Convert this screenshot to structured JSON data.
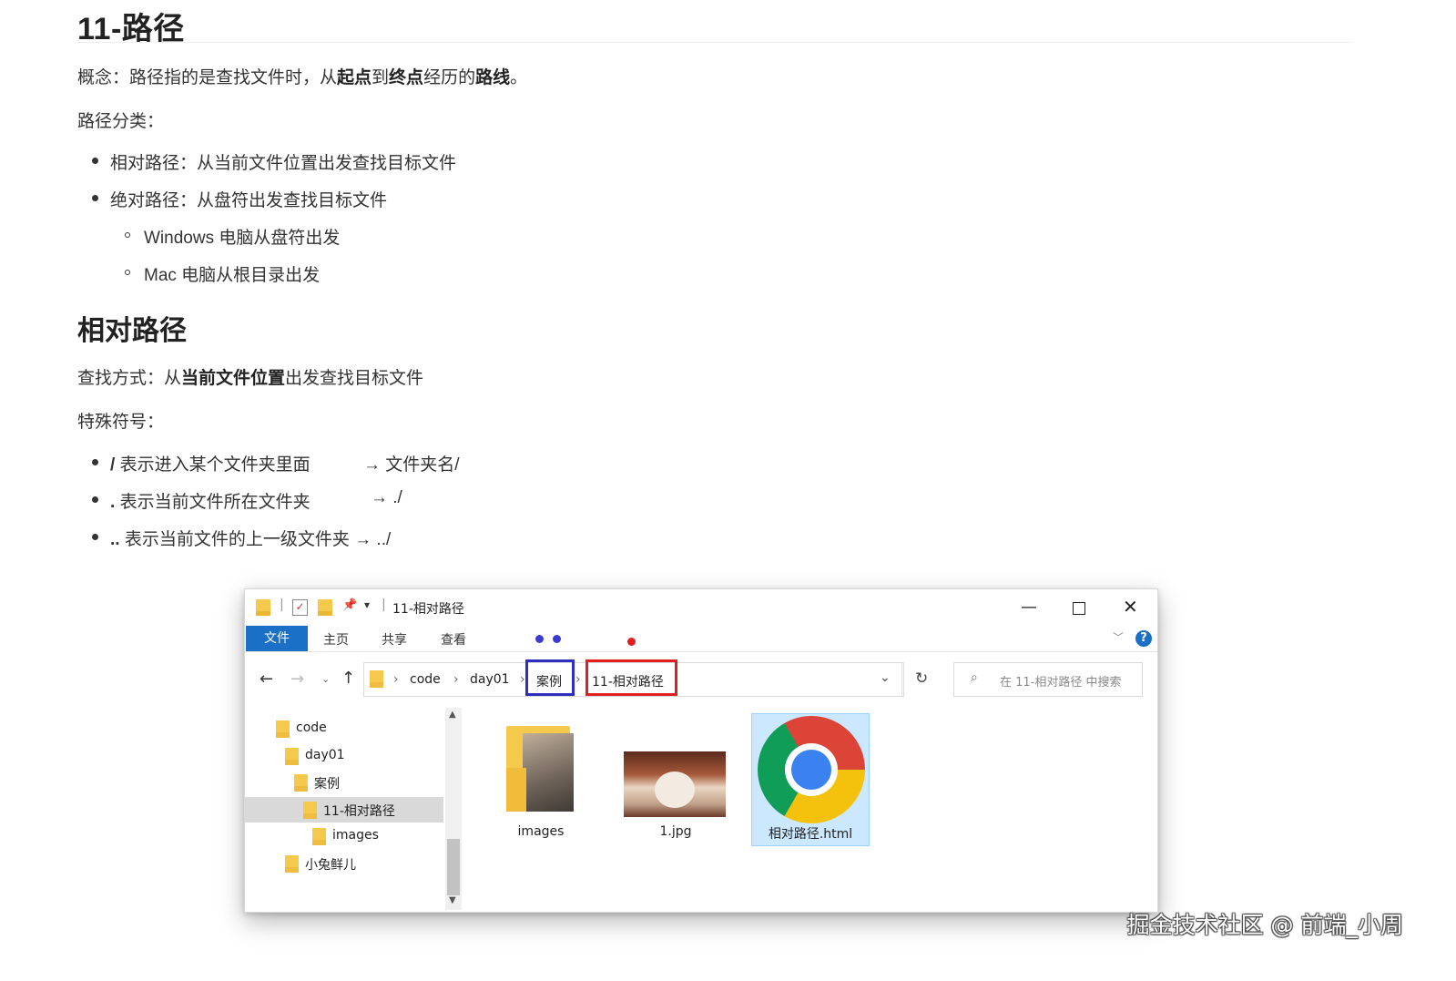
{
  "title": "11-路径",
  "concept": {
    "prefix": "概念：路径指的是查找文件时，从",
    "b1": "起点",
    "mid1": "到",
    "b2": "终点",
    "mid2": "经历的",
    "b3": "路线",
    "suffix": "。"
  },
  "path_types_label": "路径分类：",
  "path_types": [
    "相对路径：从当前文件位置出发查找目标文件",
    "绝对路径：从盘符出发查找目标文件"
  ],
  "absolute_sub": [
    "Windows 电脑从盘符出发",
    "Mac 电脑从根目录出发"
  ],
  "section2": {
    "heading": "相对路径",
    "find_prefix": "查找方式：从",
    "find_bold": "当前文件位置",
    "find_suffix": "出发查找目标文件",
    "symbols_label": "特殊符号：",
    "symbols": [
      {
        "sym": "/",
        "desc": "表示进入某个文件夹里面",
        "arrow": "→",
        "example": "文件夹名/"
      },
      {
        "sym": ".",
        "desc": "表示当前文件所在文件夹",
        "arrow": "→",
        "example": "./"
      },
      {
        "sym": "..",
        "desc": "表示当前文件的上一级文件夹",
        "arrow": "→",
        "example": "../"
      }
    ]
  },
  "explorer": {
    "window_title": "11-相对路径",
    "tabs": [
      "文件",
      "主页",
      "共享",
      "查看"
    ],
    "breadcrumbs": [
      "code",
      "day01",
      "案例",
      "11-相对路径"
    ],
    "search_placeholder": "在 11-相对路径 中搜索",
    "tree": [
      "code",
      "day01",
      "案例",
      "11-相对路径",
      "images",
      "小兔鲜儿"
    ],
    "items": [
      "images",
      "1.jpg",
      "相对路径.html"
    ],
    "colors": {
      "file_tab": "#1a6fc6",
      "blue_box": "#2f2fbf",
      "red_box": "#e02020"
    }
  },
  "watermark": "掘金技术社区 @ 前端_小周"
}
